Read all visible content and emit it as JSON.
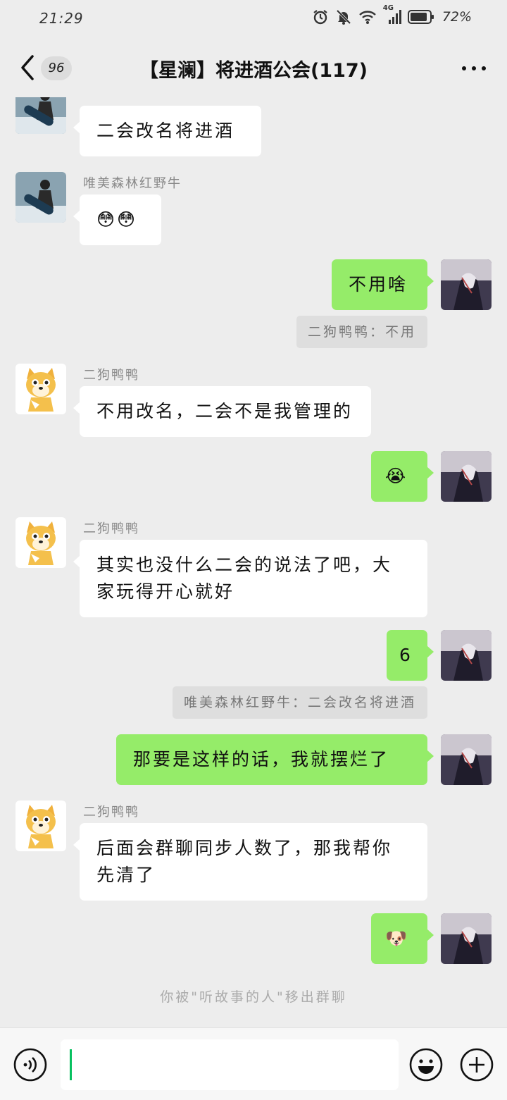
{
  "status_bar": {
    "time": "21:29",
    "network_badge": "4G",
    "battery": "72%",
    "icons": [
      "alarm-icon",
      "mute-icon",
      "wifi-icon",
      "signal-icon",
      "battery-icon"
    ]
  },
  "header": {
    "unread_count": "96",
    "title": "【星澜】将进酒公会(117)"
  },
  "messages": [
    {
      "type": "incoming",
      "sender": "",
      "avatar": "snowboarder-avatar",
      "text": "二会改名将进酒"
    },
    {
      "type": "incoming",
      "sender": "唯美森林红野牛",
      "avatar": "snowboarder-avatar",
      "text": "😳😳"
    },
    {
      "type": "outgoing",
      "avatar": "my-avatar",
      "text": "不用啥"
    },
    {
      "type": "quote",
      "text": "二狗鸭鸭：不用"
    },
    {
      "type": "incoming",
      "sender": "二狗鸭鸭",
      "avatar": "shiba-dog-avatar",
      "text": "不用改名，二会不是我管理的"
    },
    {
      "type": "outgoing",
      "avatar": "my-avatar",
      "text": "😭"
    },
    {
      "type": "incoming",
      "sender": "二狗鸭鸭",
      "avatar": "shiba-dog-avatar",
      "text": "其实也没什么二会的说法了吧，大家玩得开心就好"
    },
    {
      "type": "outgoing",
      "avatar": "my-avatar",
      "text": "6"
    },
    {
      "type": "quote",
      "text": "唯美森林红野牛：二会改名将进酒"
    },
    {
      "type": "outgoing",
      "avatar": "my-avatar",
      "text": "那要是这样的话，我就摆烂了"
    },
    {
      "type": "incoming",
      "sender": "二狗鸭鸭",
      "avatar": "shiba-dog-avatar",
      "text": "后面会群聊同步人数了，那我帮你先清了"
    },
    {
      "type": "outgoing",
      "avatar": "my-avatar",
      "text": "🐶"
    }
  ],
  "system_notice": "你被\"听故事的人\"移出群聊",
  "input_bar": {
    "value": "",
    "icons": [
      "voice-icon",
      "emoji-icon",
      "plus-icon"
    ]
  },
  "colors": {
    "background": "#ededed",
    "outgoing_bubble": "#95ec69",
    "incoming_bubble": "#ffffff",
    "caret": "#07c160"
  }
}
